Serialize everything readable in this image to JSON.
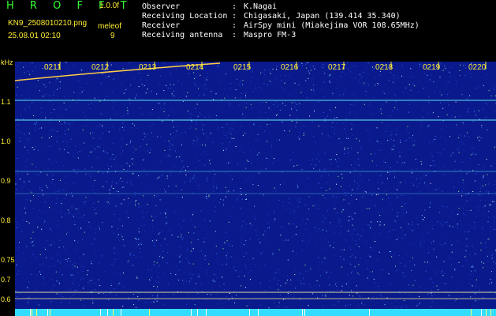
{
  "header": {
    "app_title": "H R O F F T",
    "version": "1.0.0f",
    "filename": "KN9_2508010210.png",
    "meleo_label": "meleof",
    "meleo_count": "9",
    "timestamp": "25.08.01 02:10"
  },
  "info": [
    {
      "key": "Observer",
      "sep": ":",
      "value": "K.Nagai"
    },
    {
      "key": "Receiving Location",
      "sep": ":",
      "value": "Chigasaki, Japan (139.414 35.340)"
    },
    {
      "key": "Receiver",
      "sep": ":",
      "value": "AirSpy mini (Miakejima VOR 108.65MHz)"
    },
    {
      "key": "Receiving antenna",
      "sep": ":",
      "value": "Maspro FM-3"
    }
  ],
  "y_axis": {
    "unit": "kHz",
    "labels": [
      "1.1",
      "1.0",
      "0.9",
      "0.8",
      "0.75",
      "0.7",
      "0.6"
    ]
  },
  "time_ticks": [
    "0211",
    "0212",
    "0213",
    "0214",
    "0215",
    "0216",
    "0217",
    "0218",
    "0219",
    "0220"
  ],
  "colors": {
    "background": "#0a1a8c",
    "axis_text": "#ffee33",
    "title": "#33ff33",
    "carrier": "#66ffff",
    "bottom_band": "#33ddff"
  }
}
